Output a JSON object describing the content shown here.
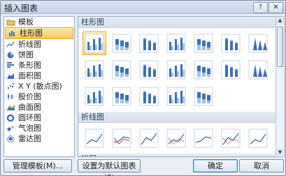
{
  "window": {
    "title": "插入图表",
    "help_label": "?",
    "close_label": "✕"
  },
  "sidebar": {
    "items": [
      {
        "label": "模板",
        "icon": "folder-icon"
      },
      {
        "label": "柱形图",
        "icon": "column-chart-icon",
        "selected": true
      },
      {
        "label": "折线图",
        "icon": "line-chart-icon"
      },
      {
        "label": "饼图",
        "icon": "pie-chart-icon"
      },
      {
        "label": "条形图",
        "icon": "bar-chart-icon"
      },
      {
        "label": "面积图",
        "icon": "area-chart-icon"
      },
      {
        "label": "X Y (散点图)",
        "icon": "scatter-chart-icon"
      },
      {
        "label": "股价图",
        "icon": "stock-chart-icon"
      },
      {
        "label": "曲面图",
        "icon": "surface-chart-icon"
      },
      {
        "label": "圆环图",
        "icon": "doughnut-chart-icon"
      },
      {
        "label": "气泡图",
        "icon": "bubble-chart-icon"
      },
      {
        "label": "雷达图",
        "icon": "radar-chart-icon"
      }
    ]
  },
  "sections": [
    {
      "header": "柱形图",
      "thumb_count": 19
    },
    {
      "header": "折线图",
      "thumb_count": 7
    },
    {
      "header": "饼图",
      "thumb_count": 0
    }
  ],
  "buttons": {
    "manage_templates": "管理模板(M)...",
    "set_default": "设置为默认图表(S)",
    "ok": "确定",
    "cancel": "取消"
  },
  "colors": {
    "selection": "#f7c95c",
    "header_text": "#1e395b",
    "chart_blue": "#3f6fb0"
  }
}
